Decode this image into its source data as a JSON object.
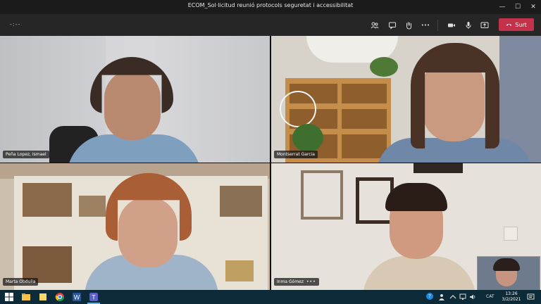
{
  "window": {
    "title": "ECOM_Sol·licitud reunió protocols seguretat i accessibilitat",
    "minimize_icon": "—",
    "maximize_icon": "☐",
    "close_icon": "✕"
  },
  "toolbar": {
    "timer": "-:--",
    "leave_label": "Surt",
    "more_icon": "•••"
  },
  "participants": [
    {
      "name": "Peña Lopez, Ismael"
    },
    {
      "name": "Montserrat Garcia"
    },
    {
      "name": "Marta Obdulia"
    },
    {
      "name": "Inma Gómez",
      "more": "•••"
    }
  ],
  "tray": {
    "language": "CAT",
    "time": "13:26",
    "date": "3/2/2021",
    "help": "?"
  },
  "colors": {
    "leave": "#c4314b",
    "taskbar": "#0c2a38"
  }
}
